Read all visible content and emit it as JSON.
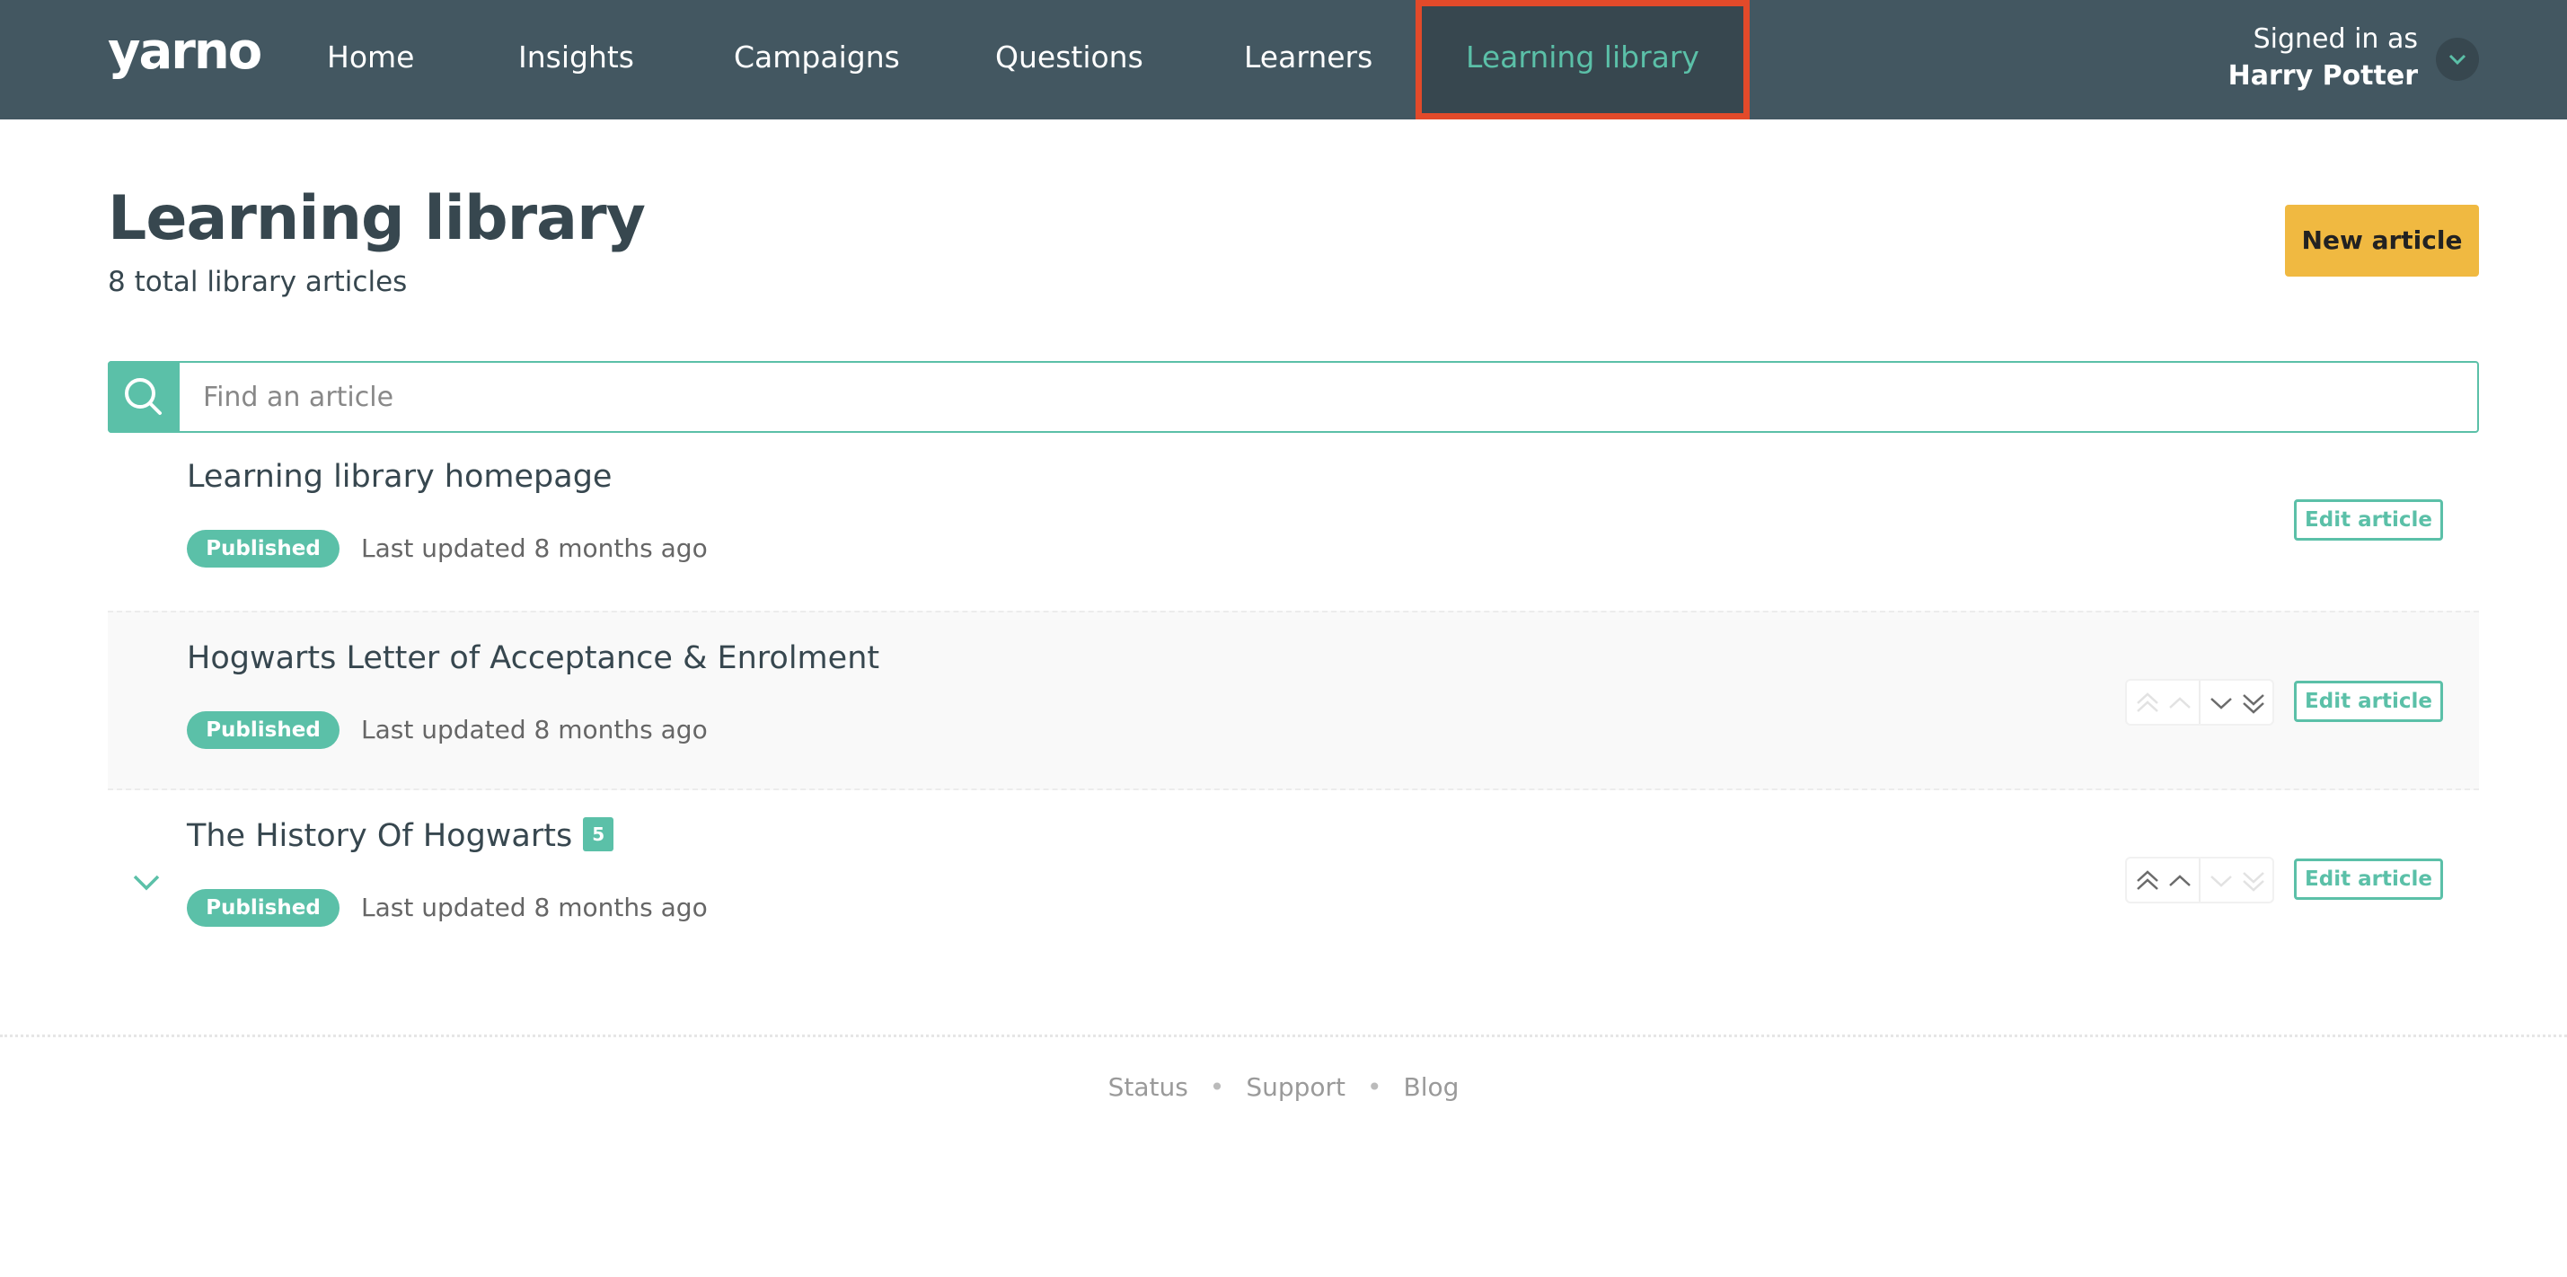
{
  "nav": {
    "logo": "yarno",
    "items": [
      {
        "label": "Home"
      },
      {
        "label": "Insights"
      },
      {
        "label": "Campaigns"
      },
      {
        "label": "Questions"
      },
      {
        "label": "Learners"
      },
      {
        "label": "Learning library"
      }
    ],
    "active_item": "Learning library",
    "user": {
      "signed_in_label": "Signed in as",
      "name": "Harry Potter"
    }
  },
  "header": {
    "title": "Learning library",
    "subtitle": "8 total library articles",
    "new_article_label": "New article"
  },
  "search": {
    "placeholder": "Find an article",
    "value": ""
  },
  "articles": [
    {
      "title": "Learning library homepage",
      "status": "Published",
      "updated": "Last updated 8 months ago",
      "edit_label": "Edit article"
    },
    {
      "title": "Hogwarts Letter of Acceptance & Enrolment",
      "status": "Published",
      "updated": "Last updated 8 months ago",
      "edit_label": "Edit article"
    },
    {
      "title": "The History Of Hogwarts",
      "badge": "5",
      "status": "Published",
      "updated": "Last updated 8 months ago",
      "edit_label": "Edit article"
    }
  ],
  "footer": {
    "links": [
      "Status",
      "Support",
      "Blog"
    ],
    "separator": "•"
  },
  "colors": {
    "nav_bg": "#435761",
    "accent": "#5bc0a8",
    "cta": "#f0b941",
    "highlight": "#e24a2a"
  }
}
